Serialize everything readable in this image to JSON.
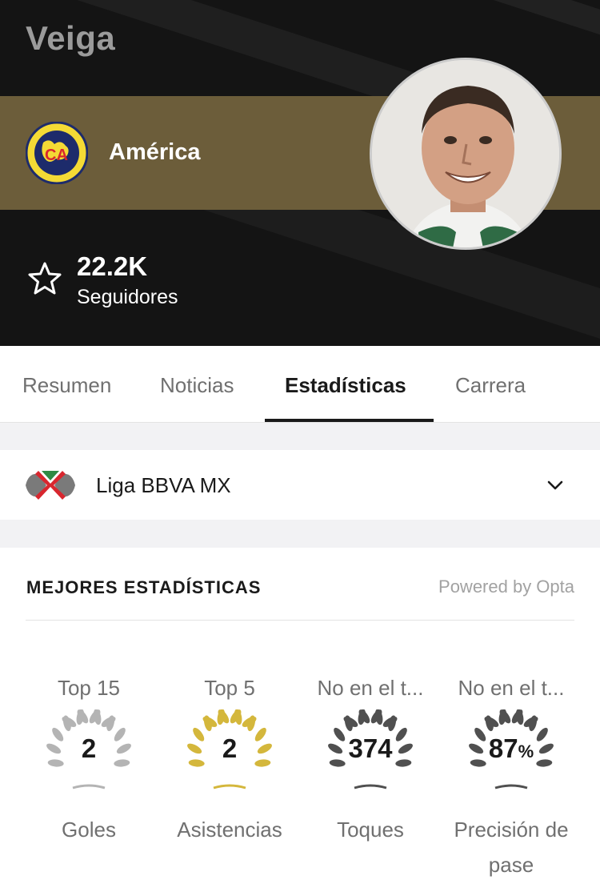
{
  "header": {
    "player_name": "Veiga",
    "team_name": "América",
    "followers_count": "22.2K",
    "followers_label": "Seguidores",
    "team_logo_text": "CA"
  },
  "tabs": [
    {
      "label": "Resumen",
      "active": false
    },
    {
      "label": "Noticias",
      "active": false
    },
    {
      "label": "Estadísticas",
      "active": true
    },
    {
      "label": "Carrera",
      "active": false
    }
  ],
  "league": {
    "name": "Liga BBVA MX",
    "icon": "chevron-down-icon"
  },
  "stats_card": {
    "title": "MEJORES ESTADÍSTICAS",
    "powered_by": "Powered by Opta",
    "items": [
      {
        "rank": "Top 15",
        "value": "2",
        "unit": "",
        "label": "Goles",
        "wreath_color": "#b4b4b4"
      },
      {
        "rank": "Top 5",
        "value": "2",
        "unit": "",
        "label": "Asistencias",
        "wreath_color": "#d4b73c"
      },
      {
        "rank": "No en el t...",
        "value": "374",
        "unit": "",
        "label": "Toques",
        "wreath_color": "#505050"
      },
      {
        "rank": "No en el t...",
        "value": "87",
        "unit": "%",
        "label": "Precisión de pase",
        "wreath_color": "#505050"
      }
    ]
  }
}
